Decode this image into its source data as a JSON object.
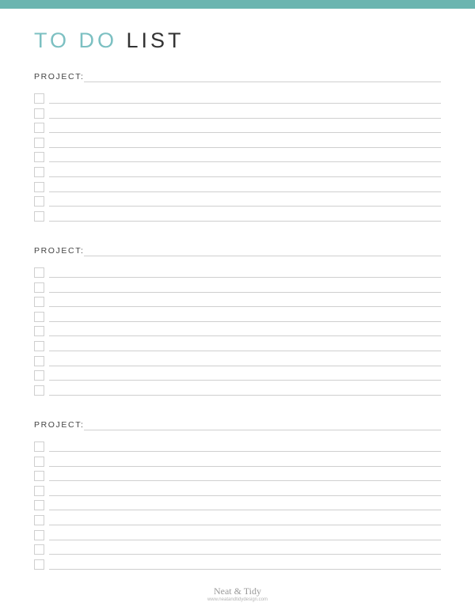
{
  "header": {
    "title_part1": "TO DO",
    "title_part2": "LIST",
    "accent_color": "#6bb5b0"
  },
  "sections": [
    {
      "label": "PROJECT:",
      "value": "",
      "items": [
        "",
        "",
        "",
        "",
        "",
        "",
        "",
        "",
        ""
      ]
    },
    {
      "label": "PROJECT:",
      "value": "",
      "items": [
        "",
        "",
        "",
        "",
        "",
        "",
        "",
        "",
        ""
      ]
    },
    {
      "label": "PROJECT:",
      "value": "",
      "items": [
        "",
        "",
        "",
        "",
        "",
        "",
        "",
        "",
        ""
      ]
    }
  ],
  "footer": {
    "brand": "Neat & Tidy",
    "url": "www.neatandtidydesign.com"
  }
}
